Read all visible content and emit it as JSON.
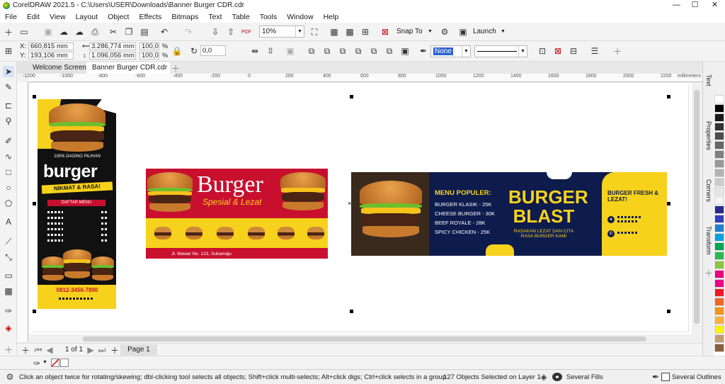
{
  "window": {
    "app_title": "CorelDRAW 2021.5 - C:\\Users\\USER\\Downloads\\Banner Burger CDR.cdr",
    "minimize": "—",
    "maximize": "☐",
    "close": "✕"
  },
  "menu": [
    "File",
    "Edit",
    "View",
    "Layout",
    "Object",
    "Effects",
    "Bitmaps",
    "Text",
    "Table",
    "Tools",
    "Window",
    "Help"
  ],
  "toolbar1": {
    "zoom": "10%",
    "snap_to": "Snap To",
    "launch": "Launch"
  },
  "propbar": {
    "x_label": "X:",
    "x_value": "660,815 mm",
    "y_label": "Y:",
    "y_value": "193,106 mm",
    "width": "3.286,774 mm",
    "height": "1.096,056 mm",
    "scale_w": "100,0",
    "scale_h": "100,0",
    "pct": "%",
    "angle": "0,0",
    "fill": "None"
  },
  "tabs": [
    {
      "label": "Welcome Screen"
    },
    {
      "label": "Banner Burger CDR.cdr"
    }
  ],
  "ruler": {
    "ticks": [
      "-1200",
      "-1000",
      "-800",
      "-600",
      "-400",
      "-200",
      "0",
      "200",
      "400",
      "600",
      "800",
      "1000",
      "1200",
      "1400",
      "1600",
      "1800",
      "2000",
      "2200"
    ],
    "unit": "millimeters"
  },
  "dockers": [
    "Text",
    "Properties",
    "Corners",
    "Transform"
  ],
  "design1": {
    "headline": "burger",
    "tag": "100% DAGING PILIHAN",
    "sub": "NIKMAT & RASA!",
    "menu_title": "DAFTAR MENU",
    "phone": "0812-3456-7890"
  },
  "design2": {
    "headline": "Burger",
    "sub": "Spesial & Lezat",
    "address": "Jl. Mawar No. 123, Sukamaju"
  },
  "design3": {
    "menu_title": "MENU POPULER:",
    "items": [
      "BURGER KLASIK - 25K",
      "CHEESE BURGER - 30K",
      "BEEF ROYALE - 28K",
      "SPICY CHICKEN - 25K"
    ],
    "brand_line1": "BURGER",
    "brand_line2": "BLAST",
    "tagline": "RASAKAN LEZAT DAN CITA RASA BURGER KAMI",
    "fresh": "BURGER FRESH & LEZAT!"
  },
  "pagebar": {
    "page_count": "1 of 1",
    "page_tab": "Page 1"
  },
  "status": {
    "hint": "Click an object twice for rotating/skewing; dbl-clicking tool selects all objects; Shift+click multi-selects; Alt+click digs; Ctrl+click selects in a group",
    "selection": "127 Objects Selected on Layer 1",
    "fills": "Several Fills",
    "outlines": "Several Outlines"
  },
  "palette_colors": [
    "#ffffff",
    "#000000",
    "#1a1a1a",
    "#333333",
    "#4d4d4d",
    "#666666",
    "#808080",
    "#999999",
    "#b3b3b3",
    "#cccccc",
    "#e6e6e6",
    "#f2f2f2",
    "#2b2b8f",
    "#2f3fbf",
    "#1f7fd0",
    "#0aa0e0",
    "#00a651",
    "#2db84d",
    "#8cc63f",
    "#e6007e",
    "#ec008c",
    "#ed1c24",
    "#f26522",
    "#f7941d",
    "#fbb040",
    "#fff200",
    "#c69c6d",
    "#8b5e3c"
  ],
  "colors": {
    "accent_yellow": "#f7d21c",
    "accent_red": "#c8102e",
    "navy": "#0e1b4d"
  }
}
